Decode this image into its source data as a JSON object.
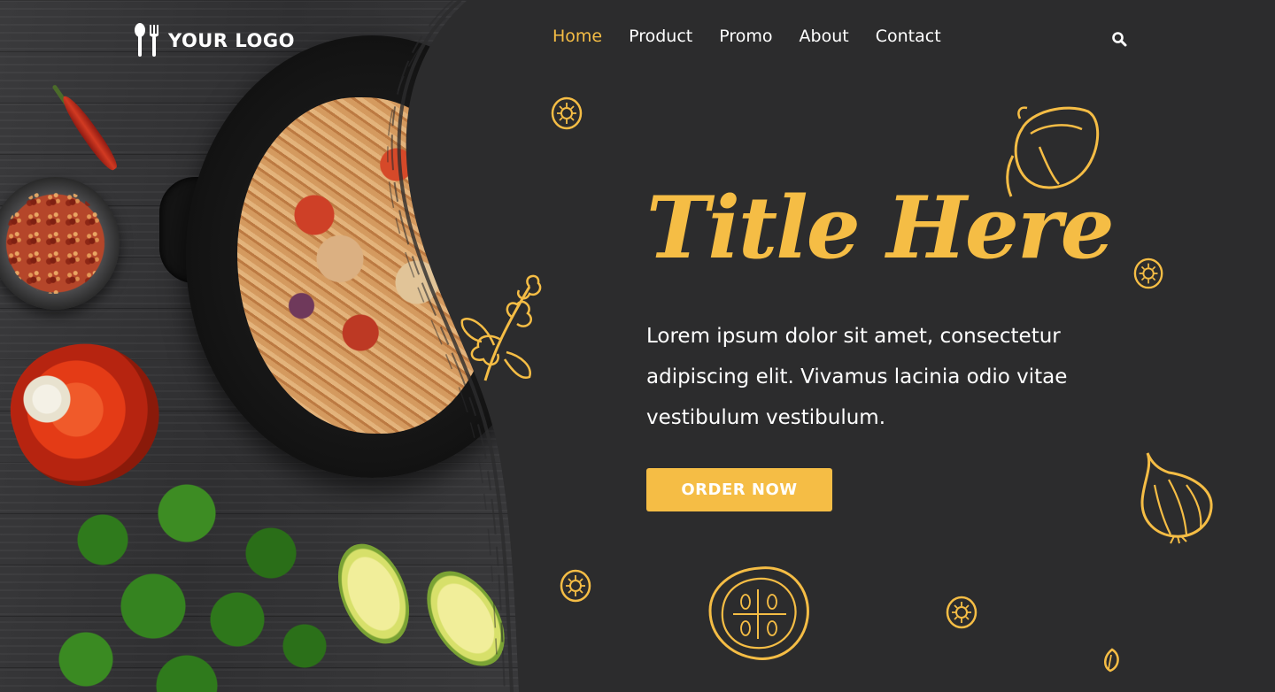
{
  "brand": {
    "logo_text": "YOUR LOGO",
    "accent_color": "#f5bd45",
    "panel_color": "#2c2c2d"
  },
  "nav": {
    "items": [
      {
        "label": "Home",
        "active": true
      },
      {
        "label": "Product",
        "active": false
      },
      {
        "label": "Promo",
        "active": false
      },
      {
        "label": "About",
        "active": false
      },
      {
        "label": "Contact",
        "active": false
      }
    ],
    "search_icon": "search-icon"
  },
  "hero": {
    "title": "Title Here",
    "description": "Lorem ipsum dolor sit amet, consectetur adipiscing elit. Vivamus lacinia odio vitae vestibulum vestibulum.",
    "cta_label": "ORDER NOW"
  },
  "decor": {
    "photo_subject": "wok-noodles-photo",
    "doodle_icons": [
      "bell-pepper-doodle-icon",
      "parsley-doodle-icon",
      "garlic-doodle-icon",
      "tomato-slice-doodle-icon",
      "lemon-slice-doodle-icon",
      "seed-doodle-icon"
    ]
  }
}
